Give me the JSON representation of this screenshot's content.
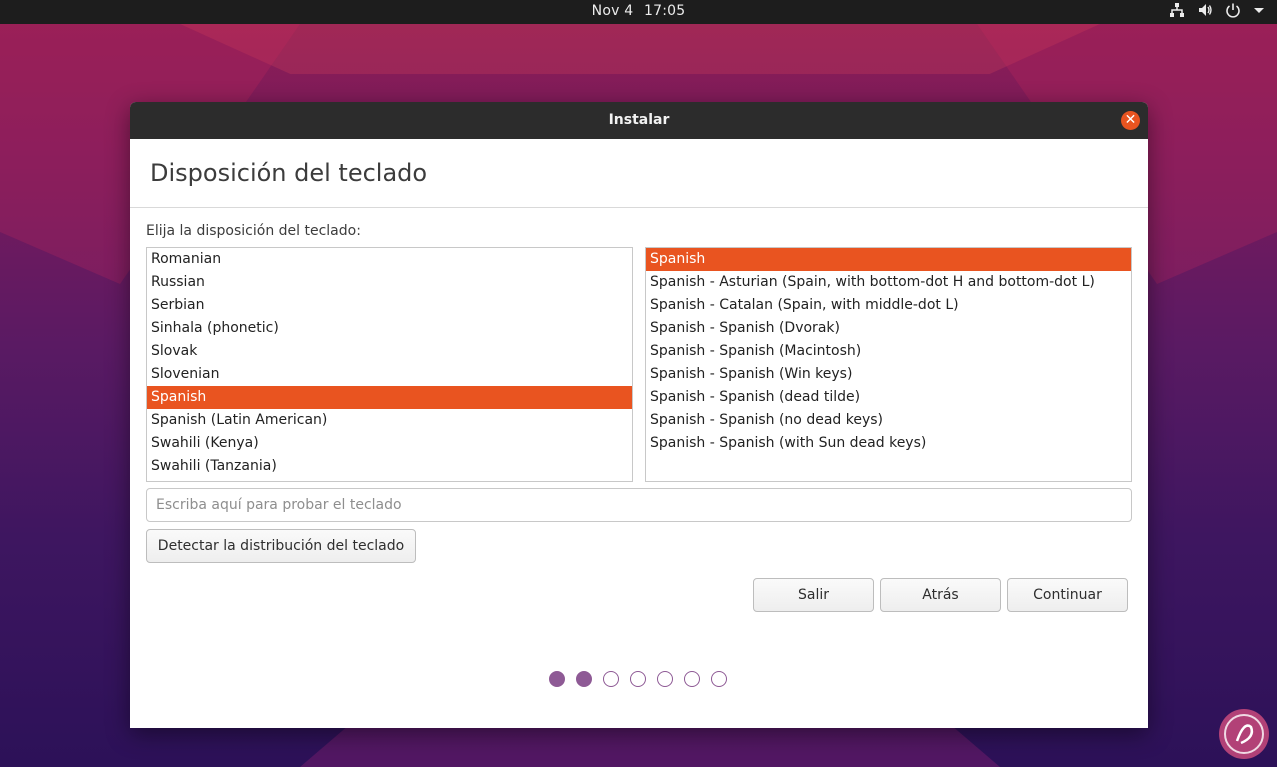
{
  "topbar": {
    "date": "Nov 4",
    "time": "17:05",
    "icons": [
      "network-icon",
      "volume-icon",
      "power-icon",
      "menu-arrow-icon"
    ]
  },
  "window": {
    "title": "Instalar",
    "close_icon": "close-icon"
  },
  "page": {
    "title": "Disposición del teclado",
    "prompt": "Elija la disposición del teclado:"
  },
  "layouts": {
    "items": [
      "Romanian",
      "Russian",
      "Serbian",
      "Sinhala (phonetic)",
      "Slovak",
      "Slovenian",
      "Spanish",
      "Spanish (Latin American)",
      "Swahili (Kenya)",
      "Swahili (Tanzania)"
    ],
    "selected": "Spanish"
  },
  "variants": {
    "items": [
      "Spanish",
      "Spanish - Asturian (Spain, with bottom-dot H and bottom-dot L)",
      "Spanish - Catalan (Spain, with middle-dot L)",
      "Spanish - Spanish (Dvorak)",
      "Spanish - Spanish (Macintosh)",
      "Spanish - Spanish (Win keys)",
      "Spanish - Spanish (dead tilde)",
      "Spanish - Spanish (no dead keys)",
      "Spanish - Spanish (with Sun dead keys)"
    ],
    "selected": "Spanish"
  },
  "test_field": {
    "value": "",
    "placeholder": "Escriba aquí para probar el teclado"
  },
  "buttons": {
    "detect": "Detectar la distribución del teclado",
    "quit": "Salir",
    "back": "Atrás",
    "continue": "Continuar"
  },
  "progress": {
    "total_steps": 7,
    "completed_steps": 2
  },
  "colors": {
    "accent": "#e95420",
    "progress": "#8e5a95",
    "titlebar": "#2c2c2c",
    "topbar": "#1d1d1d"
  }
}
